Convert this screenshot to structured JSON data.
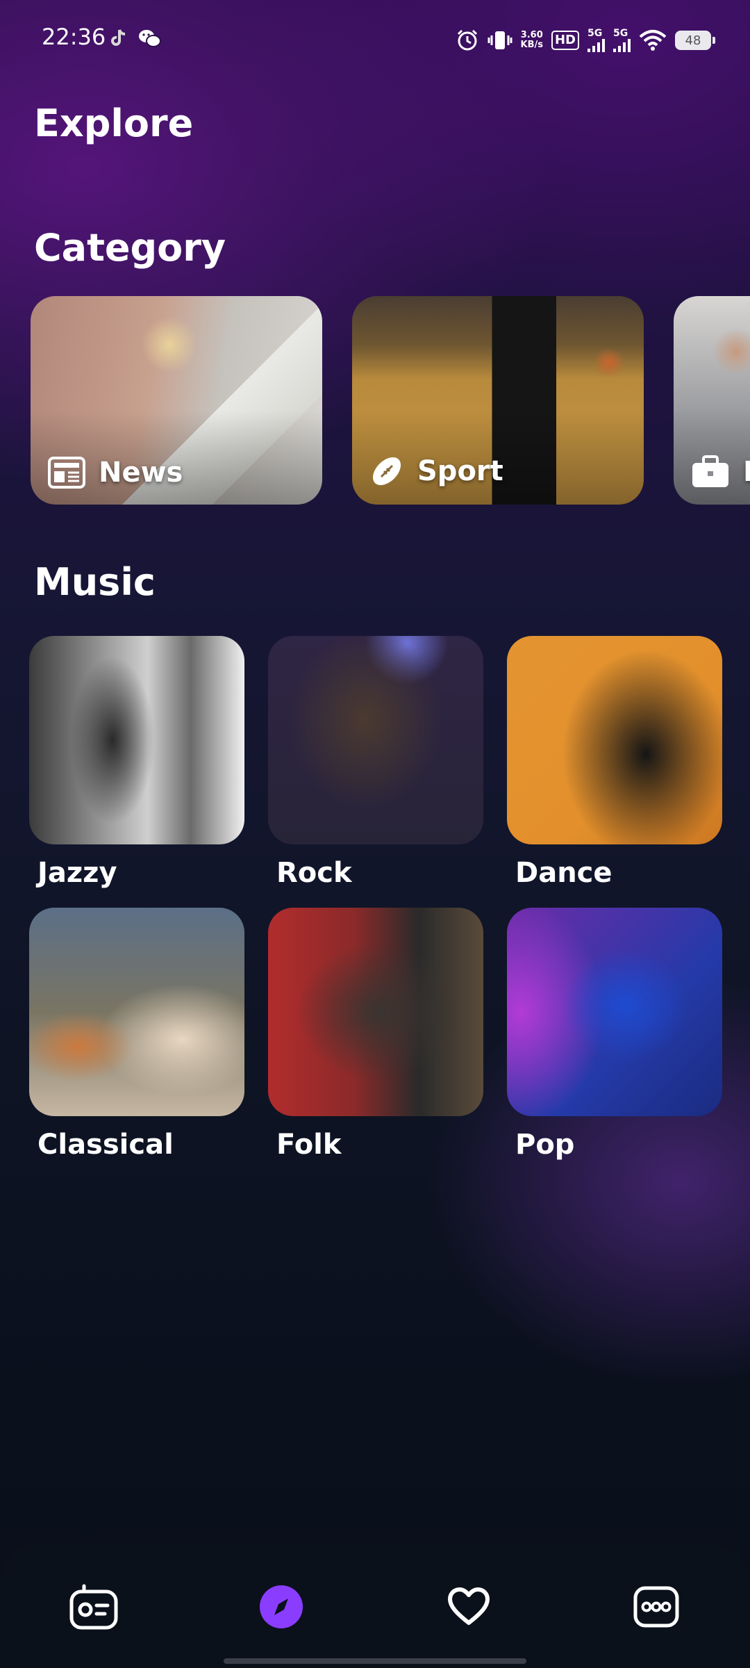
{
  "status_bar": {
    "time": "22:36",
    "network_speed_value": "3.60",
    "network_speed_unit": "KB/s",
    "hd_label": "HD",
    "sim1_label": "5G",
    "sim2_label": "5G",
    "battery": "48",
    "icons": [
      "tiktok-icon",
      "wechat-icon",
      "alarm-icon",
      "vibrate-icon",
      "hd-icon",
      "signal-icon",
      "signal-icon",
      "wifi-icon",
      "battery-icon"
    ]
  },
  "page": {
    "title": "Explore"
  },
  "category": {
    "title": "Category",
    "items": [
      {
        "label": "News",
        "icon": "newspaper-icon"
      },
      {
        "label": "Sport",
        "icon": "football-icon"
      },
      {
        "label": "B",
        "icon": "briefcase-icon"
      }
    ]
  },
  "music": {
    "title": "Music",
    "items": [
      {
        "label": "Jazzy"
      },
      {
        "label": "Rock"
      },
      {
        "label": "Dance"
      },
      {
        "label": "Classical"
      },
      {
        "label": "Folk"
      },
      {
        "label": "Pop"
      }
    ]
  },
  "bottom_nav": {
    "active": "explore",
    "accent_color": "#8b3dff",
    "items": [
      "radio-icon",
      "compass-icon",
      "heart-icon",
      "more-icon"
    ]
  }
}
